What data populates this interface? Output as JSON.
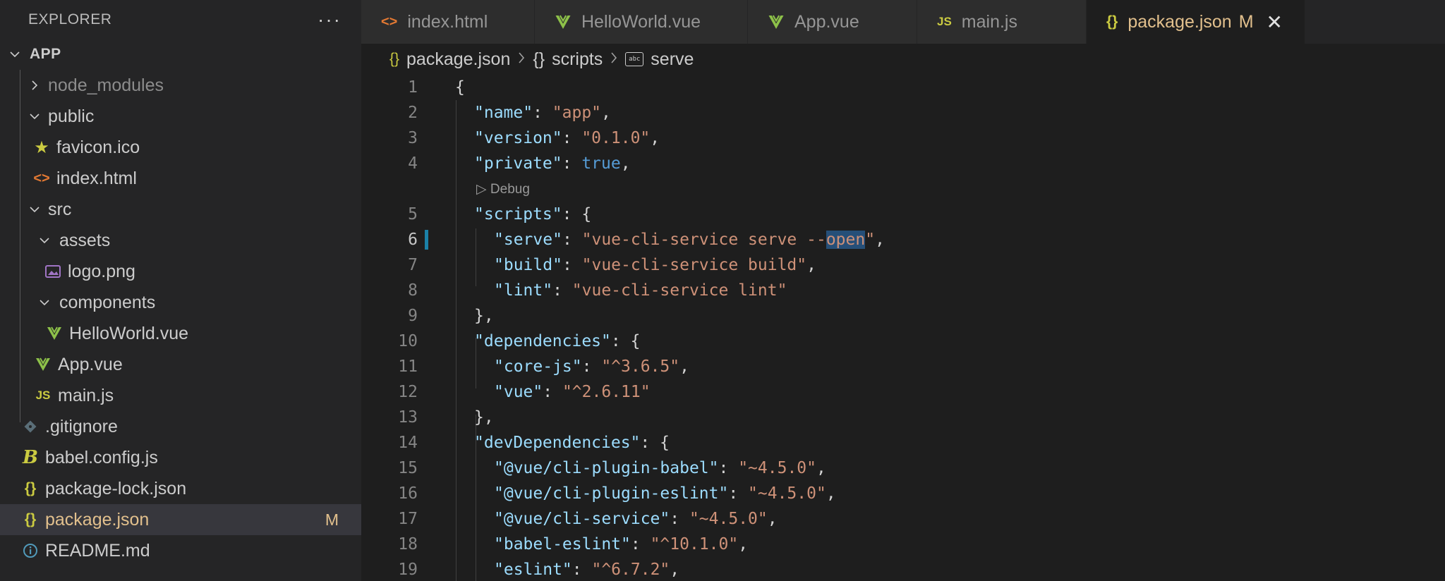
{
  "explorer": {
    "title": "EXPLORER",
    "more_label": "···",
    "root_label": "APP",
    "items": [
      {
        "label": "node_modules",
        "type": "folder",
        "collapsed": true
      },
      {
        "label": "public",
        "type": "folder",
        "collapsed": false
      },
      {
        "label": "favicon.ico",
        "icon": "star-icon"
      },
      {
        "label": "index.html",
        "icon": "html-icon",
        "icon_glyph": "<>"
      },
      {
        "label": "src",
        "type": "folder",
        "collapsed": false
      },
      {
        "label": "assets",
        "type": "folder",
        "collapsed": false
      },
      {
        "label": "logo.png",
        "icon": "image-icon"
      },
      {
        "label": "components",
        "type": "folder",
        "collapsed": false
      },
      {
        "label": "HelloWorld.vue",
        "icon": "vue-icon"
      },
      {
        "label": "App.vue",
        "icon": "vue-icon"
      },
      {
        "label": "main.js",
        "icon": "js-icon",
        "icon_glyph": "JS"
      },
      {
        "label": ".gitignore",
        "icon": "git-icon"
      },
      {
        "label": "babel.config.js",
        "icon": "babel-icon",
        "icon_glyph": "B"
      },
      {
        "label": "package-lock.json",
        "icon": "json-icon",
        "icon_glyph": "{}"
      },
      {
        "label": "package.json",
        "icon": "json-icon",
        "icon_glyph": "{}",
        "badge": "M",
        "active": true
      },
      {
        "label": "README.md",
        "icon": "info-icon"
      }
    ]
  },
  "tabs": [
    {
      "label": "index.html",
      "icon": "html-icon",
      "icon_glyph": "<>"
    },
    {
      "label": "HelloWorld.vue",
      "icon": "vue-icon"
    },
    {
      "label": "App.vue",
      "icon": "vue-icon"
    },
    {
      "label": "main.js",
      "icon": "js-icon",
      "icon_glyph": "JS"
    },
    {
      "label": "package.json",
      "icon": "json-icon",
      "icon_glyph": "{}",
      "modified": "M",
      "active": true,
      "close": "✕"
    }
  ],
  "breadcrumb": {
    "file": "package.json",
    "json_glyph": "{}",
    "scripts": "scripts",
    "serve": "serve",
    "abc_glyph": "abc"
  },
  "editor": {
    "codelens": "Debug",
    "codelens_glyph": "▷",
    "lines": [
      {
        "n": "1",
        "text": "{"
      },
      {
        "n": "2",
        "key": "\"name\"",
        "value": "\"app\"",
        "tail": ","
      },
      {
        "n": "3",
        "key": "\"version\"",
        "value": "\"0.1.0\"",
        "tail": ","
      },
      {
        "n": "4",
        "key": "\"private\"",
        "bool": "true",
        "tail": ","
      },
      {
        "n": "5",
        "key": "\"scripts\"",
        "tail": ": {"
      },
      {
        "n": "6",
        "key": "\"serve\"",
        "value_pre": "\"vue-cli-service serve --",
        "value_hl": "open",
        "value_post": "\"",
        "tail": ","
      },
      {
        "n": "7",
        "key": "\"build\"",
        "value": "\"vue-cli-service build\"",
        "tail": ","
      },
      {
        "n": "8",
        "key": "\"lint\"",
        "value": "\"vue-cli-service lint\"",
        "tail": ""
      },
      {
        "n": "9",
        "text": "},"
      },
      {
        "n": "10",
        "key": "\"dependencies\"",
        "tail": ": {"
      },
      {
        "n": "11",
        "key": "\"core-js\"",
        "value": "\"^3.6.5\"",
        "tail": ","
      },
      {
        "n": "12",
        "key": "\"vue\"",
        "value": "\"^2.6.11\"",
        "tail": ""
      },
      {
        "n": "13",
        "text": "},"
      },
      {
        "n": "14",
        "key": "\"devDependencies\"",
        "tail": ": {"
      },
      {
        "n": "15",
        "key": "\"@vue/cli-plugin-babel\"",
        "value": "\"~4.5.0\"",
        "tail": ","
      },
      {
        "n": "16",
        "key": "\"@vue/cli-plugin-eslint\"",
        "value": "\"~4.5.0\"",
        "tail": ","
      },
      {
        "n": "17",
        "key": "\"@vue/cli-service\"",
        "value": "\"~4.5.0\"",
        "tail": ","
      },
      {
        "n": "18",
        "key": "\"babel-eslint\"",
        "value": "\"^10.1.0\"",
        "tail": ","
      },
      {
        "n": "19",
        "key": "\"eslint\"",
        "value": "\"^6.7.2\"",
        "tail": ","
      }
    ]
  },
  "colors": {
    "key": "#9cdcfe",
    "string": "#ce9178",
    "boolean": "#569cd6",
    "modified": "#e2c08d",
    "vue": "#8dc149"
  }
}
